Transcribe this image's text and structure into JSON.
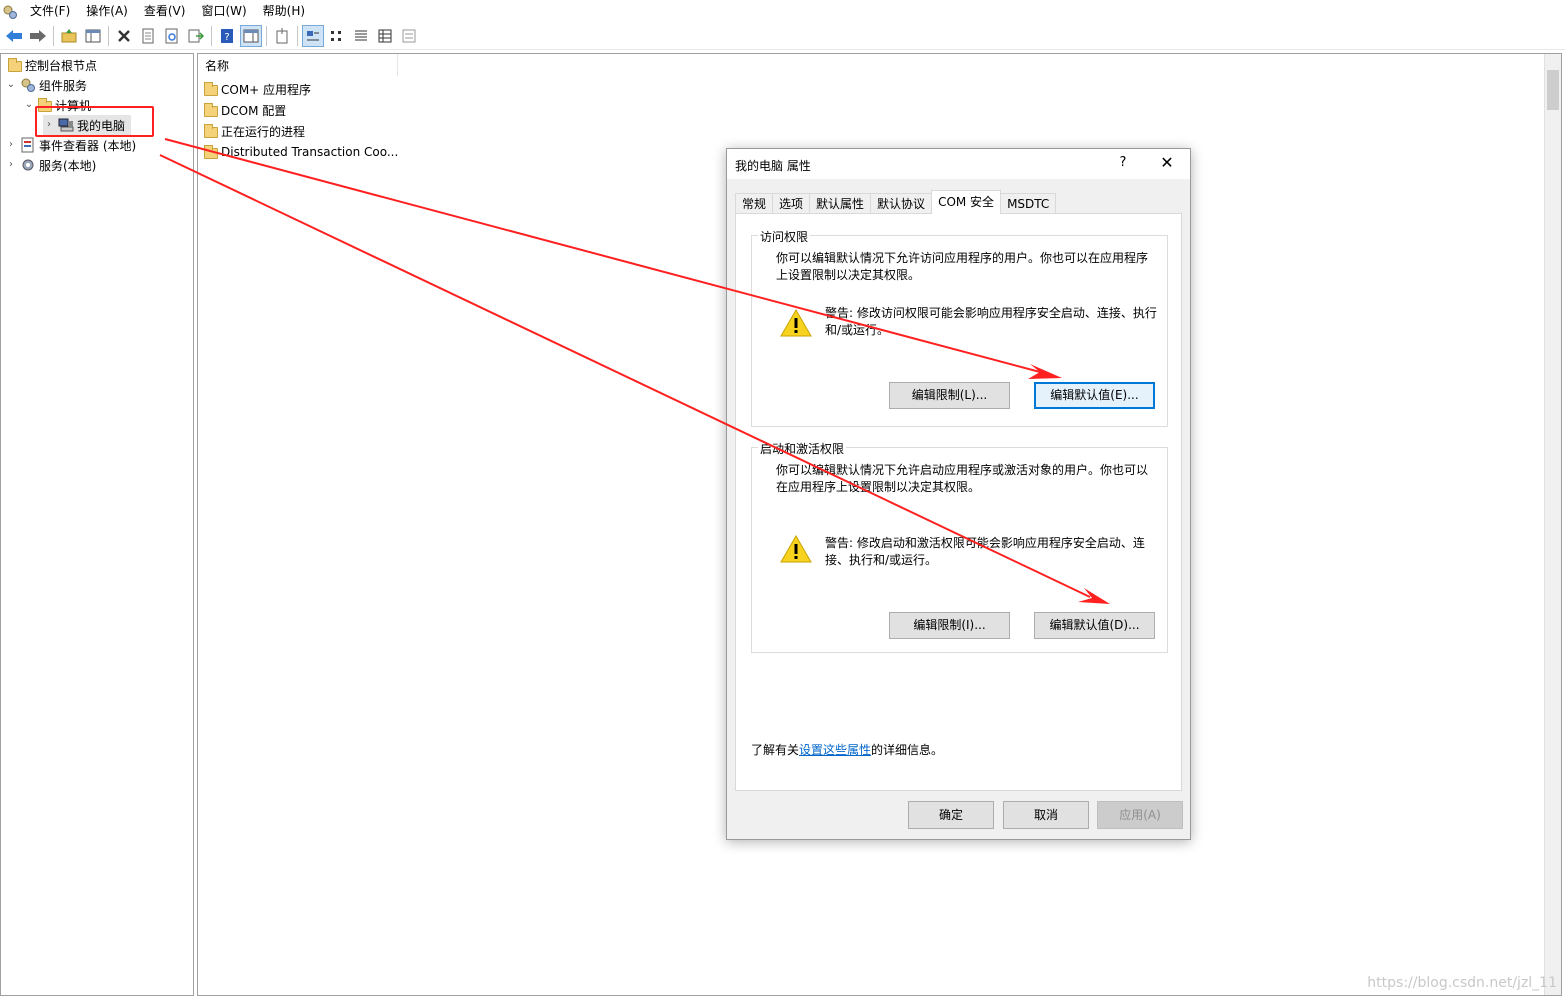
{
  "menubar": {
    "items": [
      "文件(F)",
      "操作(A)",
      "查看(V)",
      "窗口(W)",
      "帮助(H)"
    ]
  },
  "toolbar": {
    "icons": [
      "back-arrow-icon",
      "forward-arrow-icon",
      "up-folder-icon",
      "show-hide-tree-icon",
      "delete-icon",
      "properties-icon",
      "refresh-icon",
      "export-icon",
      "help-icon",
      "show-action-pane-icon",
      "new-window-icon",
      "large-icons-view-icon",
      "small-icons-view-icon",
      "list-view-icon",
      "detail-view-icon",
      "toggle-view-icon"
    ]
  },
  "tree": {
    "root": "控制台根节点",
    "component_services": "组件服务",
    "computers": "计算机",
    "my_computer": "我的电脑",
    "event_viewer": "事件查看器 (本地)",
    "services": "服务(本地)"
  },
  "list": {
    "column_name": "名称",
    "items": [
      "COM+ 应用程序",
      "DCOM 配置",
      "正在运行的进程",
      "Distributed Transaction Coo..."
    ]
  },
  "dialog": {
    "title": "我的电脑 属性",
    "help": "?",
    "close": "✕",
    "tabs": [
      "常规",
      "选项",
      "默认属性",
      "默认协议",
      "COM 安全",
      "MSDTC"
    ],
    "selected_tab": "COM 安全",
    "access": {
      "title": "访问权限",
      "desc": "你可以编辑默认情况下允许访问应用程序的用户。你也可以在应用程序上设置限制以决定其权限。",
      "warning": "警告: 修改访问权限可能会影响应用程序安全启动、连接、执行和/或运行。",
      "edit_limits": "编辑限制(L)...",
      "edit_default": "编辑默认值(E)..."
    },
    "launch": {
      "title": "启动和激活权限",
      "desc": "你可以编辑默认情况下允许启动应用程序或激活对象的用户。你也可以在应用程序上设置限制以决定其权限。",
      "warning": "警告: 修改启动和激活权限可能会影响应用程序安全启动、连接、执行和/或运行。",
      "edit_limits": "编辑限制(I)...",
      "edit_default": "编辑默认值(D)..."
    },
    "learn_more_prefix": "了解有关",
    "learn_more_link": "设置这些属性",
    "learn_more_suffix": "的详细信息。",
    "ok": "确定",
    "cancel": "取消",
    "apply": "应用(A)"
  },
  "annotation_color": "#ff2020",
  "watermark": "https://blog.csdn.net/jzl_11"
}
